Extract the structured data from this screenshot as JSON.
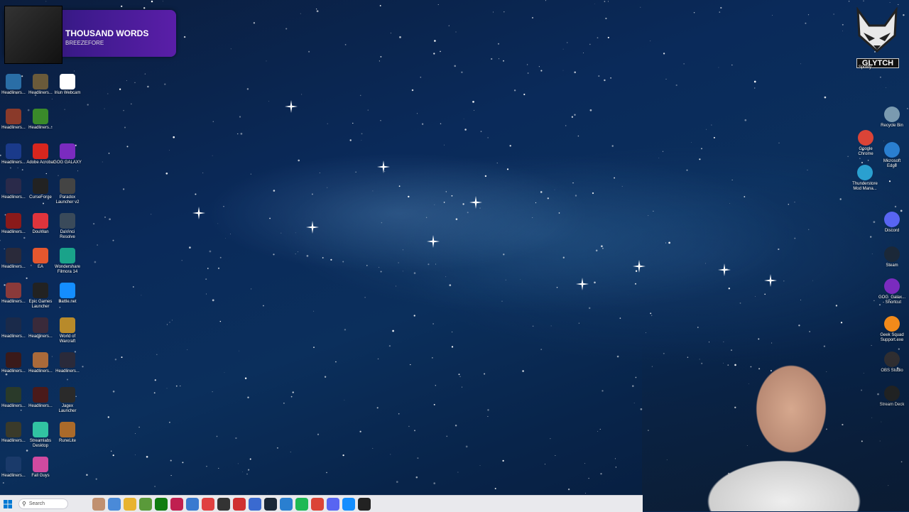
{
  "now_playing": {
    "title": "THOUSAND WORDS",
    "artist": "BREEZEFORE"
  },
  "brand": {
    "logo_text": "GLYTCH"
  },
  "desktop_icons_left": [
    {
      "name": "headliners-1",
      "label": "Headliners...",
      "color": "#2a6ea6"
    },
    {
      "name": "headliners-2",
      "label": "Headliners...",
      "color": "#6a5a3a"
    },
    {
      "name": "iriun-webcam",
      "label": "Iriun Webcam",
      "color": "#ffffff"
    },
    {
      "name": "headliners-3",
      "label": "Headliners...",
      "color": "#8a3a2a"
    },
    {
      "name": "headliners-4",
      "label": "Headliners...",
      "color": "#3a8a2a"
    },
    {
      "name": "headliners-5",
      "label": "Headliners...",
      "color": "#1a3a8a"
    },
    {
      "name": "adobe-acrobat",
      "label": "Adobe Acrobat",
      "color": "#d7261e"
    },
    {
      "name": "gog-galaxy",
      "label": "GOG GALAXY",
      "color": "#7a2bbf"
    },
    {
      "name": "headliners-6",
      "label": "Headliners...",
      "color": "#2a2a4a"
    },
    {
      "name": "curseforge",
      "label": "CurseForge",
      "color": "#222222"
    },
    {
      "name": "paradox-launcher",
      "label": "Paradox Launcher v2",
      "color": "#444444"
    },
    {
      "name": "headliners-7",
      "label": "Headliners...",
      "color": "#8a1a1a"
    },
    {
      "name": "douwan",
      "label": "DouWan",
      "color": "#e0343c"
    },
    {
      "name": "davinci-resolve",
      "label": "DaVinci Resolve",
      "color": "#3a4a5a"
    },
    {
      "name": "headliners-8",
      "label": "Headliners...",
      "color": "#2a2a3a"
    },
    {
      "name": "ea",
      "label": "EA",
      "color": "#e4572e"
    },
    {
      "name": "wondershare-filmora",
      "label": "Wondershare Filmora 14",
      "color": "#1aa38a"
    },
    {
      "name": "headliners-9",
      "label": "Headliners...",
      "color": "#8a3a3a"
    },
    {
      "name": "epic-games",
      "label": "Epic Games Launcher",
      "color": "#222222"
    },
    {
      "name": "battle-net",
      "label": "Battle.net",
      "color": "#148eff"
    },
    {
      "name": "headliners-10",
      "label": "Headliners...",
      "color": "#1a2a4a"
    },
    {
      "name": "headliners-11",
      "label": "Headliners...",
      "color": "#3a2a3a"
    },
    {
      "name": "world-of-warcraft",
      "label": "World of Warcraft",
      "color": "#b88a2a"
    },
    {
      "name": "headliners-12",
      "label": "Headliners...",
      "color": "#3a1a1a"
    },
    {
      "name": "headliners-13",
      "label": "Headliners...",
      "color": "#aa6a3a"
    },
    {
      "name": "headliners-14",
      "label": "Headliners...",
      "color": "#2a2a3a"
    },
    {
      "name": "headliners-15",
      "label": "Headliners...",
      "color": "#2a3a2a"
    },
    {
      "name": "headliners-16",
      "label": "Headliners...",
      "color": "#4a1a1a"
    },
    {
      "name": "jagex-launcher",
      "label": "Jagex Launcher",
      "color": "#2a2a2a"
    },
    {
      "name": "headliners-17",
      "label": "Headliners...",
      "color": "#3a3a2a"
    },
    {
      "name": "streamlabs-desktop",
      "label": "Streamlabs Desktop",
      "color": "#31c3a2"
    },
    {
      "name": "runelite",
      "label": "RuneLite",
      "color": "#aa6a2a"
    },
    {
      "name": "headliners-18",
      "label": "Headliners...",
      "color": "#1a3a6a"
    },
    {
      "name": "fall-guys",
      "label": "Fall Guys",
      "color": "#d04aa0"
    }
  ],
  "desktop_icons_right": [
    {
      "name": "spotify",
      "label": "Spotify",
      "color": "#1db954"
    },
    {
      "name": "recycle-bin",
      "label": "Recycle Bin",
      "color": "#7a9ab0"
    },
    {
      "name": "google-chrome",
      "label": "Google Chrome",
      "color": "#db4437"
    },
    {
      "name": "microsoft-edge",
      "label": "Microsoft Edge",
      "color": "#2a7fd0"
    },
    {
      "name": "thunderstore",
      "label": "Thunderstore Mod Mana...",
      "color": "#2aa0d0"
    },
    {
      "name": "discord",
      "label": "Discord",
      "color": "#5865f2"
    },
    {
      "name": "steam",
      "label": "Steam",
      "color": "#1b2838"
    },
    {
      "name": "gog-galaxy-shortcut",
      "label": "GOG_Galax... - Shortcut",
      "color": "#7a2bbf"
    },
    {
      "name": "geek-squad",
      "label": "Geek Squad Support.exe",
      "color": "#f28a1a"
    },
    {
      "name": "obs-studio",
      "label": "OBS Studio",
      "color": "#302e31"
    },
    {
      "name": "stream-deck",
      "label": "Stream Deck",
      "color": "#222222"
    }
  ],
  "taskbar": {
    "search_placeholder": "Search",
    "apps": [
      {
        "name": "widget",
        "color": "#c09070"
      },
      {
        "name": "copilot",
        "color": "#4a8ad8"
      },
      {
        "name": "file-explorer",
        "color": "#e8b330"
      },
      {
        "name": "minecraft",
        "color": "#5a9a3a"
      },
      {
        "name": "xbox",
        "color": "#107c10"
      },
      {
        "name": "affinity",
        "color": "#c02050"
      },
      {
        "name": "store",
        "color": "#3a7ad0"
      },
      {
        "name": "calendar",
        "color": "#e04040"
      },
      {
        "name": "app-dark",
        "color": "#333333"
      },
      {
        "name": "app-red",
        "color": "#d03030"
      },
      {
        "name": "app-blue",
        "color": "#3a6ad0"
      },
      {
        "name": "steam",
        "color": "#1b2838"
      },
      {
        "name": "edge",
        "color": "#2a7fd0"
      },
      {
        "name": "spotify",
        "color": "#1db954"
      },
      {
        "name": "chrome",
        "color": "#db4437"
      },
      {
        "name": "discord",
        "color": "#5865f2"
      },
      {
        "name": "battle-net",
        "color": "#148eff"
      },
      {
        "name": "curseforge",
        "color": "#222222"
      }
    ]
  }
}
